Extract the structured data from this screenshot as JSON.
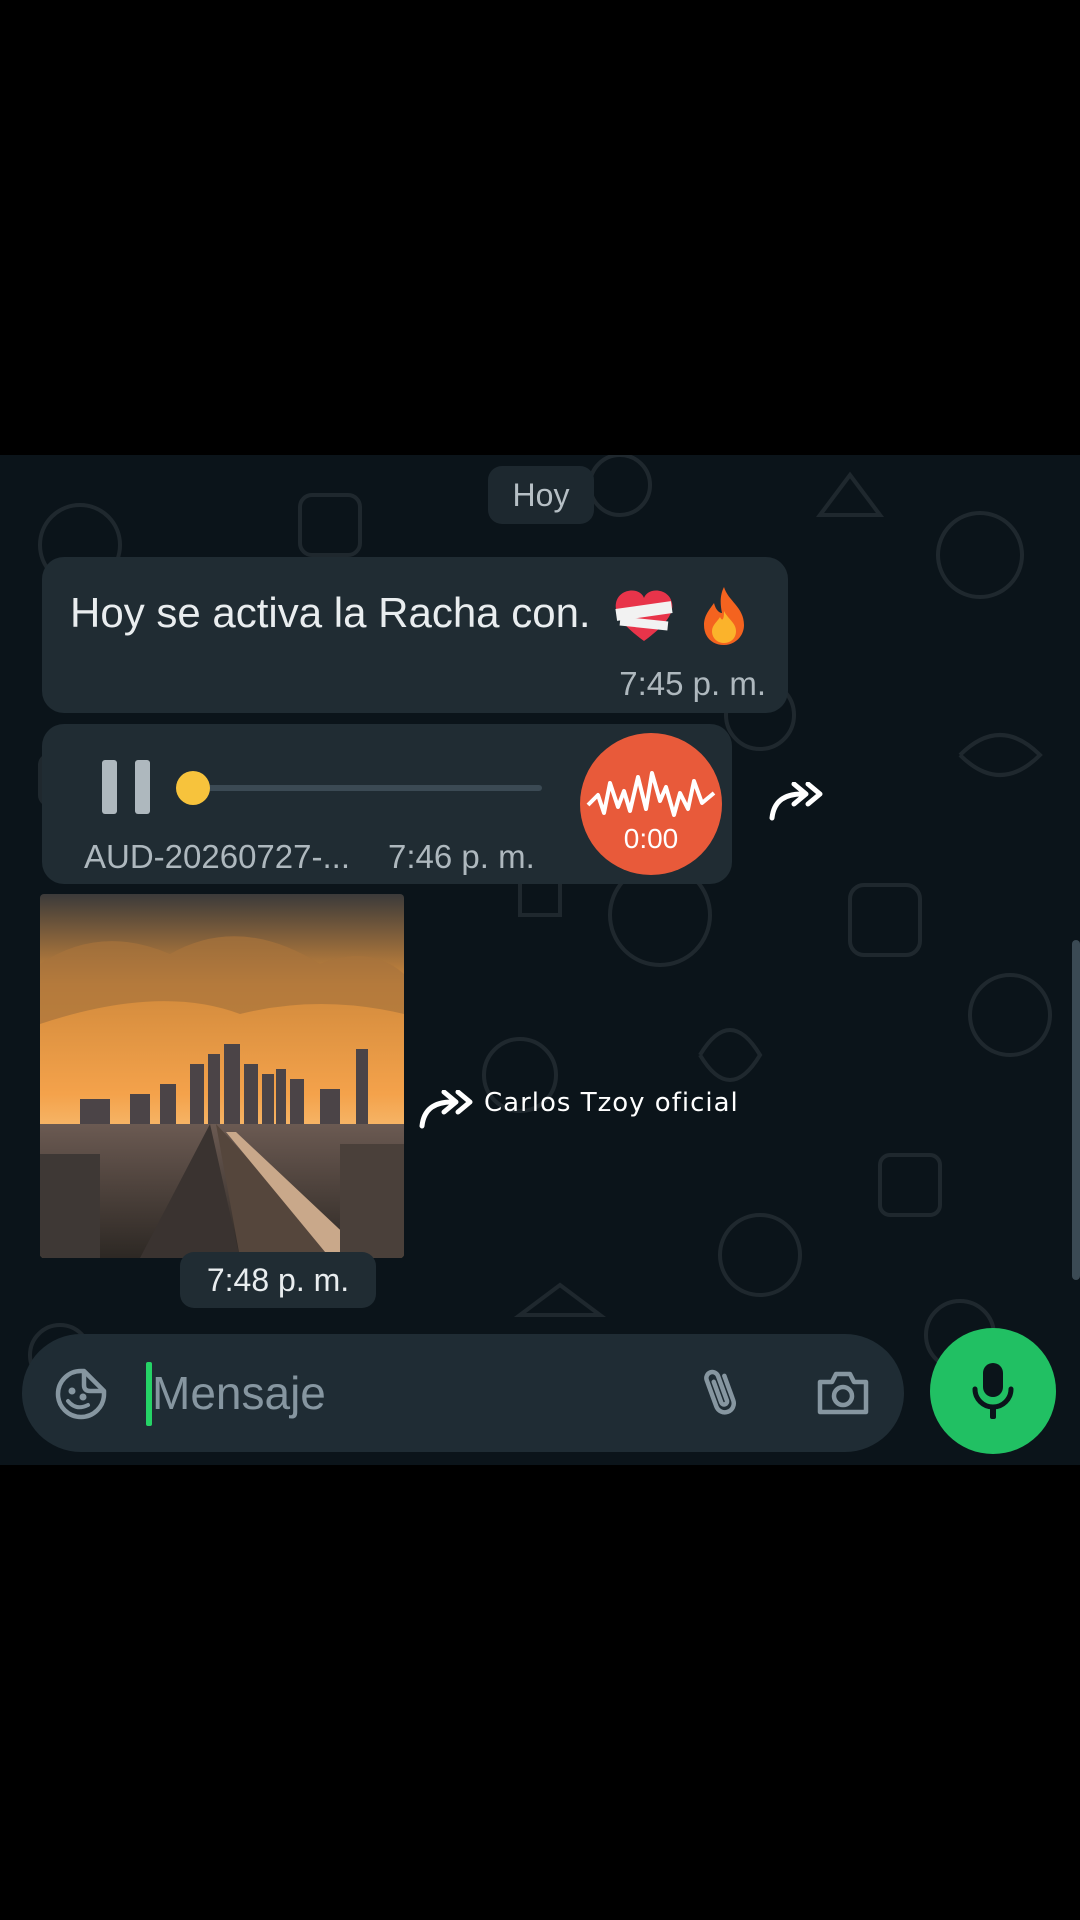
{
  "chat": {
    "date_separator": "Hoy",
    "messages": [
      {
        "type": "text",
        "text": "Hoy se activa la Racha con.",
        "emojis": [
          "mending-heart",
          "fire"
        ],
        "time": "7:45 p. m."
      },
      {
        "type": "audio",
        "status": "playing",
        "progress": 0.0,
        "file_name": "AUD-20260727-...",
        "time": "7:46 p. m.",
        "duration_label": "0:00",
        "forwarded": true
      },
      {
        "type": "image",
        "description_icon": "city-sunset-photo",
        "time": "7:48 p. m.",
        "forwarded": true
      }
    ]
  },
  "watermark": "Carlos Tzoy oficial",
  "composer": {
    "placeholder": "Mensaje",
    "icons": [
      "sticker-icon",
      "attach-icon",
      "camera-icon",
      "mic-icon"
    ]
  },
  "colors": {
    "chat_bg": "#0b141a",
    "bubble": "#202c33",
    "accent_green": "#21c063",
    "audio_avatar": "#e85a3a",
    "progress_knob": "#f7c33c"
  }
}
